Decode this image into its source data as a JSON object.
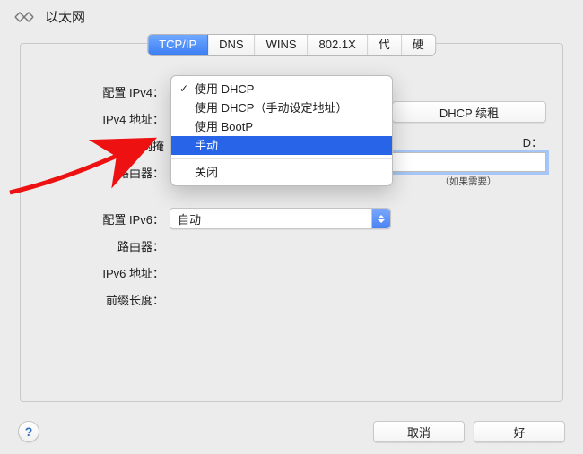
{
  "header": {
    "title": "以太网"
  },
  "tabs": [
    "TCP/IP",
    "DNS",
    "WINS",
    "802.1X",
    "代理",
    "硬件"
  ],
  "labels": {
    "configure_ipv4": "配置 IPv4：",
    "ipv4_address": "IPv4 地址：",
    "subnet_mask": "子网掩",
    "router": "路由器：",
    "configure_ipv6": "配置 IPv6：",
    "router2": "路由器：",
    "ipv6_address": "IPv6 地址：",
    "prefix_length": "前缀长度："
  },
  "ipv4_menu": {
    "items": [
      "使用 DHCP",
      "使用 DHCP（手动设定地址）",
      "使用 BootP",
      "手动",
      "关闭"
    ],
    "checked_index": 0,
    "highlight_index": 3
  },
  "ipv6_select": {
    "value": "自动"
  },
  "right": {
    "dhcp_renew": "DHCP 续租",
    "client_id_label": "D：",
    "hint": "（如果需要）",
    "client_id_value": ""
  },
  "footer": {
    "help": "?",
    "cancel": "取消",
    "ok": "好"
  }
}
